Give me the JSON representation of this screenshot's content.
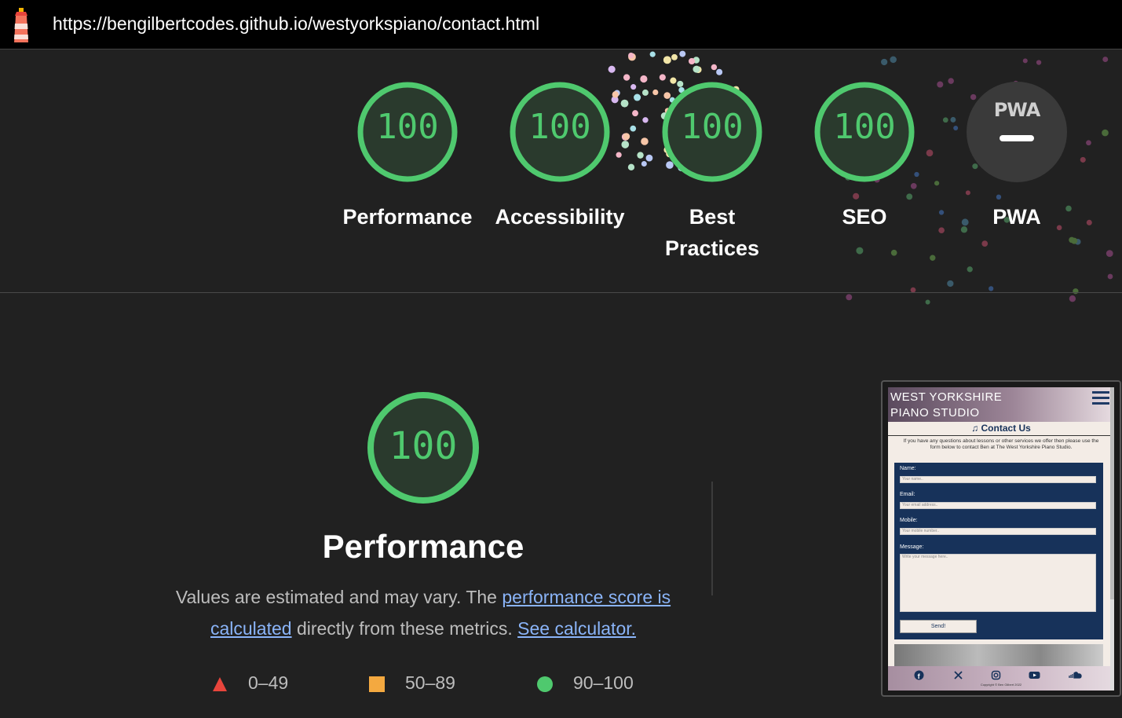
{
  "url": "https://bengilbertcodes.github.io/westyorkspiano/contact.html",
  "colors": {
    "pass": "#4fc96e",
    "average": "#f4a940",
    "fail": "#e8453c",
    "link": "#8ab4f8"
  },
  "categories": [
    {
      "score": "100",
      "label": "Performance"
    },
    {
      "score": "100",
      "label": "Accessibility"
    },
    {
      "score": "100",
      "label": "Best Practices"
    },
    {
      "score": "100",
      "label": "SEO"
    },
    {
      "score": "PWA",
      "label": "PWA"
    }
  ],
  "performance": {
    "score": "100",
    "title": "Performance",
    "desc_prefix": "Values are estimated and may vary. The ",
    "desc_link1": "performance score is calculated",
    "desc_middle": " directly from these metrics. ",
    "desc_link2": "See calculator."
  },
  "legend": [
    {
      "icon": "fail-triangle-icon",
      "range": "0–49"
    },
    {
      "icon": "average-square-icon",
      "range": "50–89"
    },
    {
      "icon": "pass-circle-icon",
      "range": "90–100"
    }
  ],
  "thumbnail": {
    "brand": "WEST YORKSHIRE PIANO STUDIO",
    "heading": "Contact Us",
    "intro": "If you have any questions about lessons or other services we offer then please use the form below to contact Ben at The West Yorkshire Piano Studio.",
    "fields": [
      {
        "label": "Name:",
        "placeholder": "Your name.."
      },
      {
        "label": "Email:",
        "placeholder": "Your email address.."
      },
      {
        "label": "Mobile:",
        "placeholder": "Your mobile number.."
      },
      {
        "label": "Message:",
        "placeholder": "Write your message here.."
      }
    ],
    "button": "Send!",
    "copyright": "Copyright © Ben Gilbert 2022"
  }
}
